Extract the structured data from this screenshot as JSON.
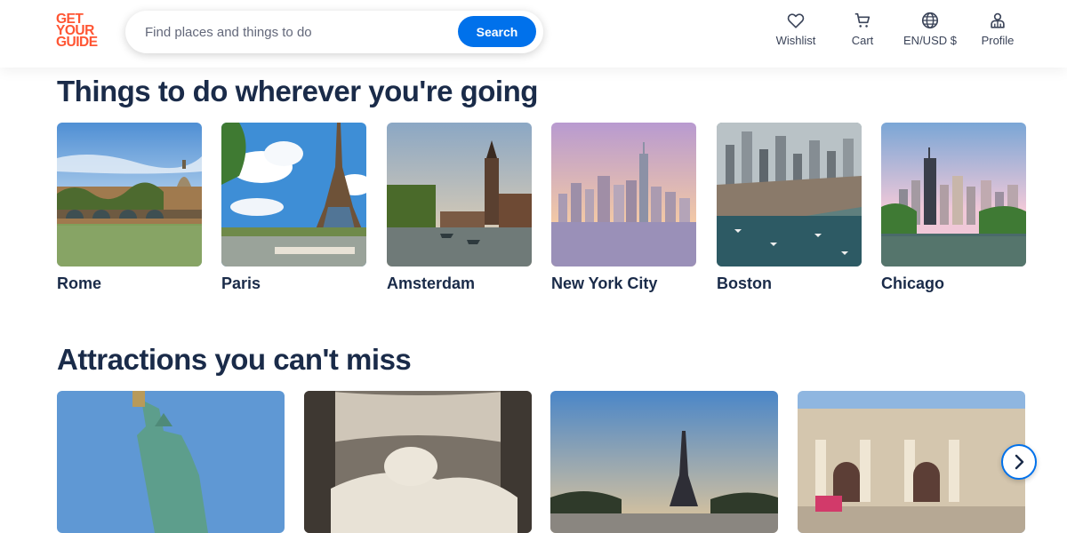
{
  "brand": {
    "line1": "GET",
    "line2": "YOUR",
    "line3": "GUIDE",
    "color": "#ff5533"
  },
  "search": {
    "placeholder": "Find places and things to do",
    "button_label": "Search",
    "accent": "#0071eb"
  },
  "nav": [
    {
      "label": "Wishlist",
      "icon": "heart-icon"
    },
    {
      "label": "Cart",
      "icon": "cart-icon"
    },
    {
      "label": "EN/USD $",
      "icon": "globe-icon"
    },
    {
      "label": "Profile",
      "icon": "profile-icon"
    }
  ],
  "destinations": {
    "heading": "Things to do wherever you're going",
    "items": [
      "Rome",
      "Paris",
      "Amsterdam",
      "New York City",
      "Boston",
      "Chicago"
    ]
  },
  "attractions": {
    "heading": "Attractions you can't miss"
  }
}
